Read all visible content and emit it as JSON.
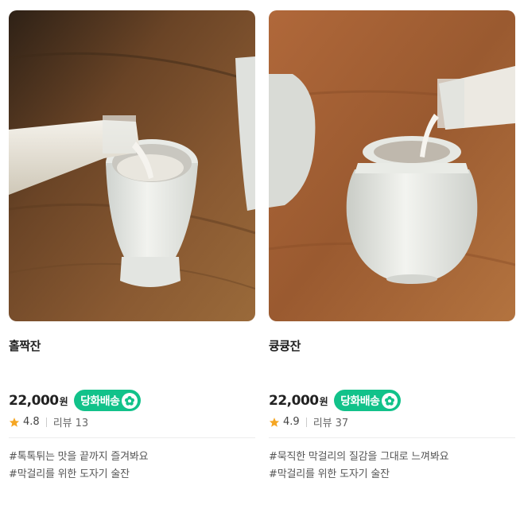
{
  "products": [
    {
      "image": "makgeolli-poured-into-tall-white-cup",
      "name": "홀짝잔",
      "price": "22,000",
      "price_unit": "원",
      "badge": "당화배송",
      "badge_icon": "flower-icon",
      "rating": "4.8",
      "review_label": "리뷰",
      "review_count": "13",
      "tags": [
        "#톡톡튀는 맛을 끝까지 즐겨봐요",
        "#막걸리를 위한 도자기 술잔"
      ]
    },
    {
      "image": "makgeolli-poured-into-round-white-jar-cup",
      "name": "큥큥잔",
      "price": "22,000",
      "price_unit": "원",
      "badge": "당화배송",
      "badge_icon": "flower-icon",
      "rating": "4.9",
      "review_label": "리뷰",
      "review_count": "37",
      "tags": [
        "#묵직한 막걸리의 질감을 그대로 느껴봐요",
        "#막걸리를 위한 도자기 술잔"
      ]
    }
  ],
  "colors": {
    "badge": "#12c28a",
    "star": "#f5a623"
  }
}
